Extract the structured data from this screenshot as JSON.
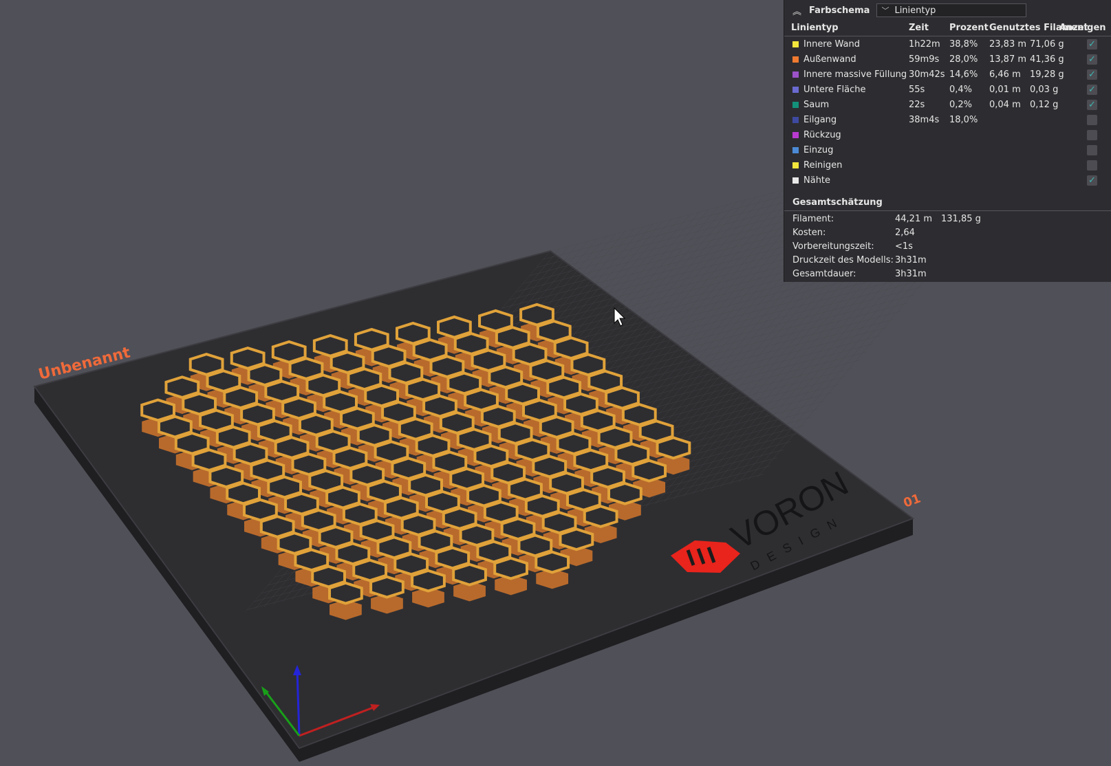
{
  "plate": {
    "name_label": "Unbenannt",
    "plate_number": "01",
    "brand_main": "VORON",
    "brand_sub": "DESIGN"
  },
  "legend": {
    "color_scheme_label": "Farbschema",
    "color_scheme_value": "Linientyp",
    "headers": [
      "Linientyp",
      "Zeit",
      "Prozent",
      "Genutztes Filament",
      "",
      "Anzeigen"
    ],
    "rows": [
      {
        "name": "Innere Wand",
        "time": "1h22m",
        "percent": "38,8%",
        "length": "23,83 m",
        "weight": "71,06 g",
        "color": "#f2e63c",
        "shown": true
      },
      {
        "name": "Außenwand",
        "time": "59m9s",
        "percent": "28,0%",
        "length": "13,87 m",
        "weight": "41,36 g",
        "color": "#f07a30",
        "shown": true
      },
      {
        "name": "Innere massive Füllung",
        "time": "30m42s",
        "percent": "14,6%",
        "length": "6,46 m",
        "weight": "19,28 g",
        "color": "#9c52c9",
        "shown": true
      },
      {
        "name": "Untere Fläche",
        "time": "55s",
        "percent": "0,4%",
        "length": "0,01 m",
        "weight": "0,03 g",
        "color": "#6a6ad1",
        "shown": true
      },
      {
        "name": "Saum",
        "time": "22s",
        "percent": "0,2%",
        "length": "0,04 m",
        "weight": "0,12 g",
        "color": "#13917a",
        "shown": true
      },
      {
        "name": "Eilgang",
        "time": "38m4s",
        "percent": "18,0%",
        "length": "",
        "weight": "",
        "color": "#3e4aa0",
        "shown": false
      },
      {
        "name": "Rückzug",
        "time": "",
        "percent": "",
        "length": "",
        "weight": "",
        "color": "#b93ad1",
        "shown": false
      },
      {
        "name": "Einzug",
        "time": "",
        "percent": "",
        "length": "",
        "weight": "",
        "color": "#4c8ad6",
        "shown": false
      },
      {
        "name": "Reinigen",
        "time": "",
        "percent": "",
        "length": "",
        "weight": "",
        "color": "#f2e63c",
        "shown": false
      },
      {
        "name": "Nähte",
        "time": "",
        "percent": "",
        "length": "",
        "weight": "",
        "color": "#e8e8e8",
        "shown": true
      }
    ],
    "estimate_title": "Gesamtschätzung",
    "estimates": [
      {
        "label": "Filament:",
        "value": "44,21 m",
        "value2": "131,85 g"
      },
      {
        "label": "Kosten:",
        "value": "2,64",
        "value2": ""
      },
      {
        "label": "Vorbereitungszeit:",
        "value": "<1s",
        "value2": ""
      },
      {
        "label": "Druckzeit des Modells:",
        "value": "3h31m",
        "value2": ""
      },
      {
        "label": "Gesamtdauer:",
        "value": "3h31m",
        "value2": ""
      }
    ]
  },
  "colors": {
    "wall_outer": "#b86a2c",
    "wall_inner": "#e0a23a",
    "plate": "#2e2e31",
    "background": "#505058",
    "accent": "#ef6a3a"
  }
}
